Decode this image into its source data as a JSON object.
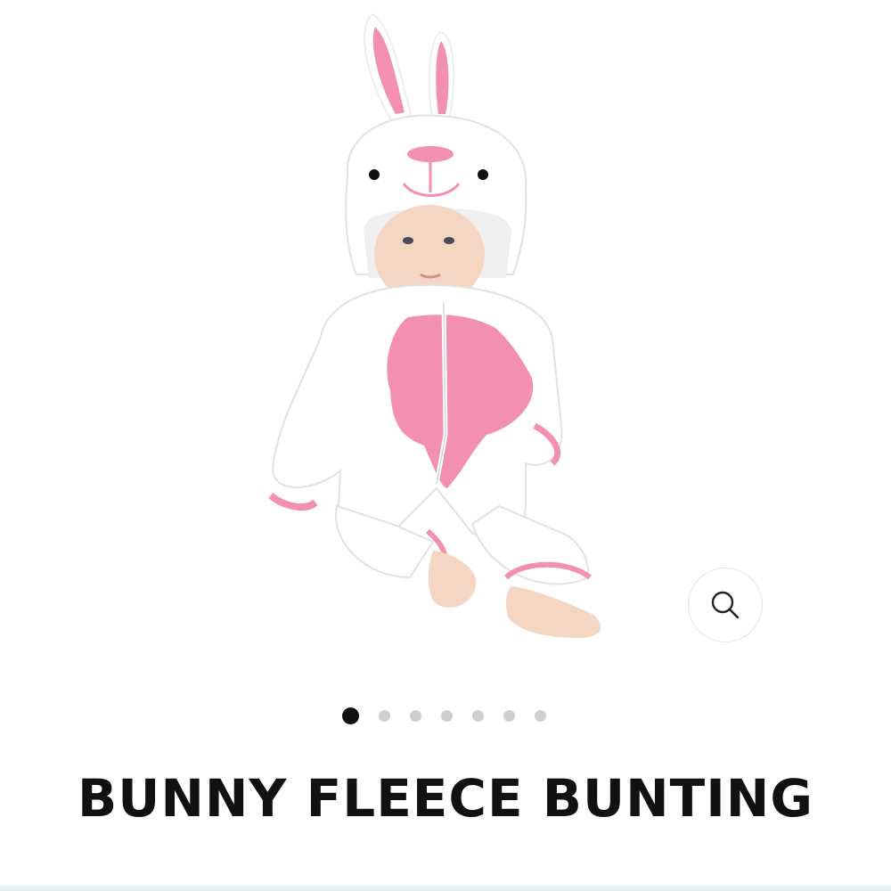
{
  "product": {
    "title": "BUNNY FLEECE BUNTING",
    "image_alt": "Baby wearing a white and pink bunny fleece bunting"
  },
  "gallery": {
    "slide_count": 7,
    "active_index": 0
  },
  "zoom": {
    "icon": "search-icon"
  },
  "colors": {
    "accent_pink": "#f38fb0",
    "fleece_white": "#ffffff",
    "active_dot": "#111111",
    "inactive_dot": "#cfcfcf"
  }
}
